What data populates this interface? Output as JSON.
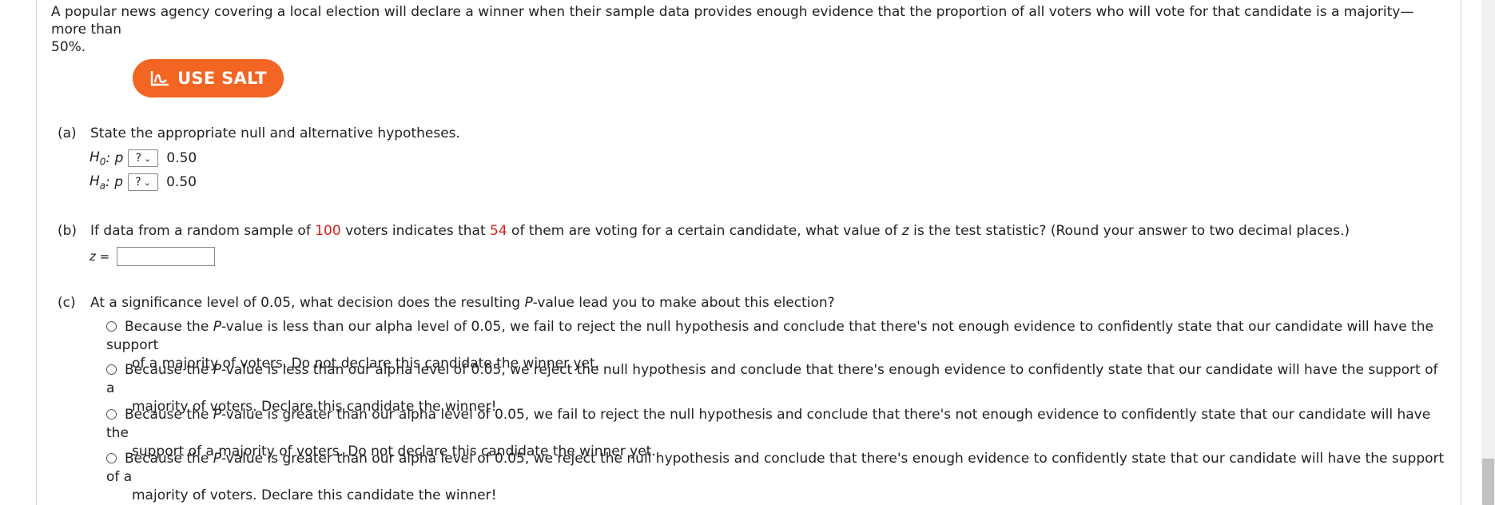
{
  "intro": {
    "line1": "A popular news agency covering a local election will declare a winner when their sample data provides enough evidence that the proportion of all voters who will vote for that candidate is a majority—more than",
    "line2": "50%."
  },
  "salt_button": {
    "label": "USE SALT",
    "icon": "salt-chart-icon",
    "color": "#f26522"
  },
  "part_a": {
    "label": "(a)",
    "question": "State the appropriate null and alternative hypotheses.",
    "h0": {
      "symbol": "H",
      "sub": "0",
      "var": ": p",
      "select_value": "?",
      "value": "0.50"
    },
    "ha": {
      "symbol": "H",
      "sub": "a",
      "var": ": p",
      "select_value": "?",
      "value": "0.50"
    }
  },
  "part_b": {
    "label": "(b)",
    "q_pre1": "If data from a random sample of ",
    "n": "100",
    "q_pre2": " voters indicates that ",
    "x": "54",
    "q_pre3": " of them are voting for a certain candidate, what value of ",
    "zvar": "z",
    "q_post": " is the test statistic? (Round your answer to two decimal places.)",
    "z_label": "z =",
    "z_value": "",
    "highlight_color": "#d21f1f"
  },
  "part_c": {
    "label": "(c)",
    "q_pre": "At a significance level of 0.05, what decision does the resulting ",
    "q_p": "P",
    "q_post": "-value lead you to make about this election?",
    "options": [
      {
        "pre": "Because the ",
        "p": "P",
        "l1": "-value is less than our alpha level of 0.05, we fail to reject the null hypothesis and conclude that there's not enough evidence to confidently state that our candidate will have the support",
        "l2": "of a majority of voters. Do not declare this candidate the winner yet."
      },
      {
        "pre": "Because the ",
        "p": "P",
        "l1": "-value is less than our alpha level of 0.05, we reject the null hypothesis and conclude that there's enough evidence to confidently state that our candidate will have the support of a",
        "l2": "majority of voters. Declare this candidate the winner!"
      },
      {
        "pre": "Because the ",
        "p": "P",
        "l1": "-value is greater than our alpha level of 0.05, we fail to reject the null hypothesis and conclude that there's not enough evidence to confidently state that our candidate will have the",
        "l2": "support of a majority of voters. Do not declare this candidate the winner yet."
      },
      {
        "pre": "Because the ",
        "p": "P",
        "l1": "-value is greater than our alpha level of 0.05, we reject the null hypothesis and conclude that there's enough evidence to confidently state that our candidate will have the support of a",
        "l2": "majority of voters. Declare this candidate the winner!"
      }
    ]
  }
}
